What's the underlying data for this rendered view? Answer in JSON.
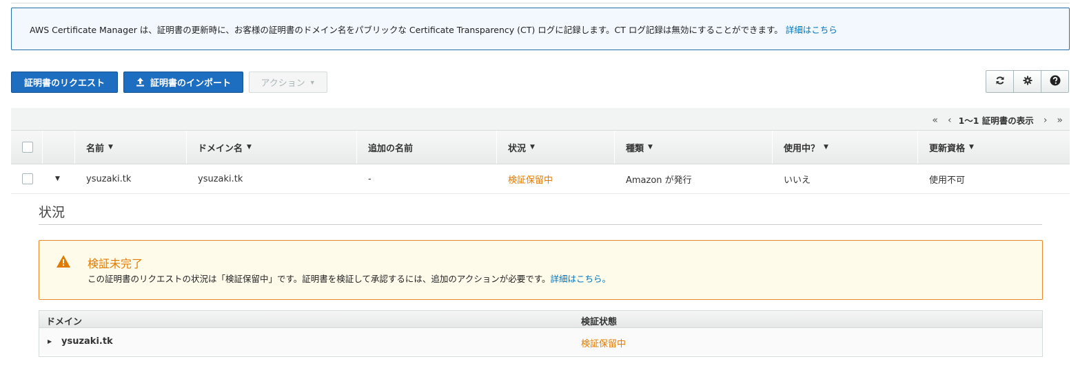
{
  "banner": {
    "text": "AWS Certificate Manager は、証明書の更新時に、お客様の証明書のドメイン名をパブリックな Certificate Transparency (CT) ログに記録します。CT ログ記録は無効にすることができます。",
    "link": "詳細はこちら"
  },
  "toolbar": {
    "request_label": "証明書のリクエスト",
    "import_label": "証明書のインポート",
    "action_label": "アクション",
    "icons": [
      "refresh-icon",
      "gear-icon",
      "help-icon"
    ]
  },
  "pager": {
    "first": "«",
    "prev": "‹",
    "label": "1～1 証明書の表示",
    "next": "›",
    "last": "»"
  },
  "table": {
    "columns": [
      "名前",
      "ドメイン名",
      "追加の名前",
      "状況",
      "種類",
      "使用中？",
      "更新資格"
    ],
    "row": {
      "name": "ysuzaki.tk",
      "domain": "ysuzaki.tk",
      "additional": "-",
      "status": "検証保留中",
      "type": "Amazon が発行",
      "in_use": "いいえ",
      "renewal": "使用不可"
    }
  },
  "detail": {
    "title": "状況",
    "warning": {
      "title": "検証未完了",
      "text": "この証明書のリクエストの状況は「検証保留中」です。証明書を検証して承認するには、追加のアクションが必要です。",
      "link": "詳細はこちら。"
    },
    "domains": {
      "col_domain": "ドメイン",
      "col_status": "検証状態",
      "rows": [
        {
          "domain": "ysuzaki.tk",
          "status": "検証保留中"
        }
      ]
    }
  },
  "colors": {
    "primary": "#1d6ec0",
    "link": "#0073bb",
    "pending": "#e07b00",
    "warning_border": "#e8872b"
  }
}
